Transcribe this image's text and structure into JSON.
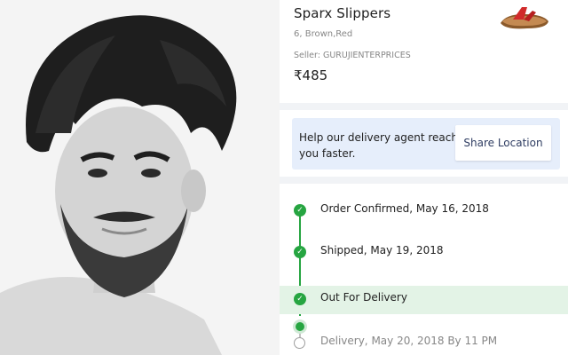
{
  "product": {
    "name": "Sparx Slippers",
    "variant": "6, Brown,Red",
    "seller": "Seller: GURUJIENTERPRICES",
    "price": "₹485",
    "thumbnail_icon": "slipper-icon"
  },
  "location_prompt": {
    "message": "Help our delivery agent reach you faster.",
    "button_label": "Share Location"
  },
  "tracking": {
    "steps": [
      {
        "label": "Order Confirmed, May 16, 2018",
        "status": "done"
      },
      {
        "label": "Shipped, May 19, 2018",
        "status": "done"
      },
      {
        "label": "Out For Delivery",
        "status": "current"
      },
      {
        "label": "Delivery, May 20, 2018 By 11 PM",
        "status": "pending"
      }
    ]
  },
  "colors": {
    "accent_green": "#26a541",
    "card_blue": "#e6eefb",
    "active_row": "#e3f3e6",
    "text_primary": "#212121",
    "text_secondary": "#878787"
  }
}
